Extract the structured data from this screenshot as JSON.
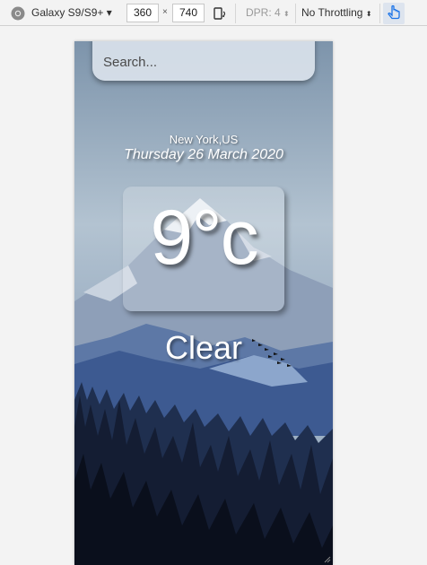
{
  "devtools": {
    "device": "Galaxy S9/S9+ ▾",
    "width": "360",
    "times": "×",
    "height": "740",
    "dpr": "DPR: 4",
    "throttling": "No Throttling"
  },
  "app": {
    "search_placeholder": "Search...",
    "location": "New York,US",
    "date": "Thursday 26 March 2020",
    "temperature": "9°c",
    "condition": "Clear"
  },
  "colors": {
    "sky_top": "#8ea4b8",
    "mountain_far": "#6d86ad",
    "mountain_mid": "#3f5f97",
    "forest": "#0d1220"
  }
}
